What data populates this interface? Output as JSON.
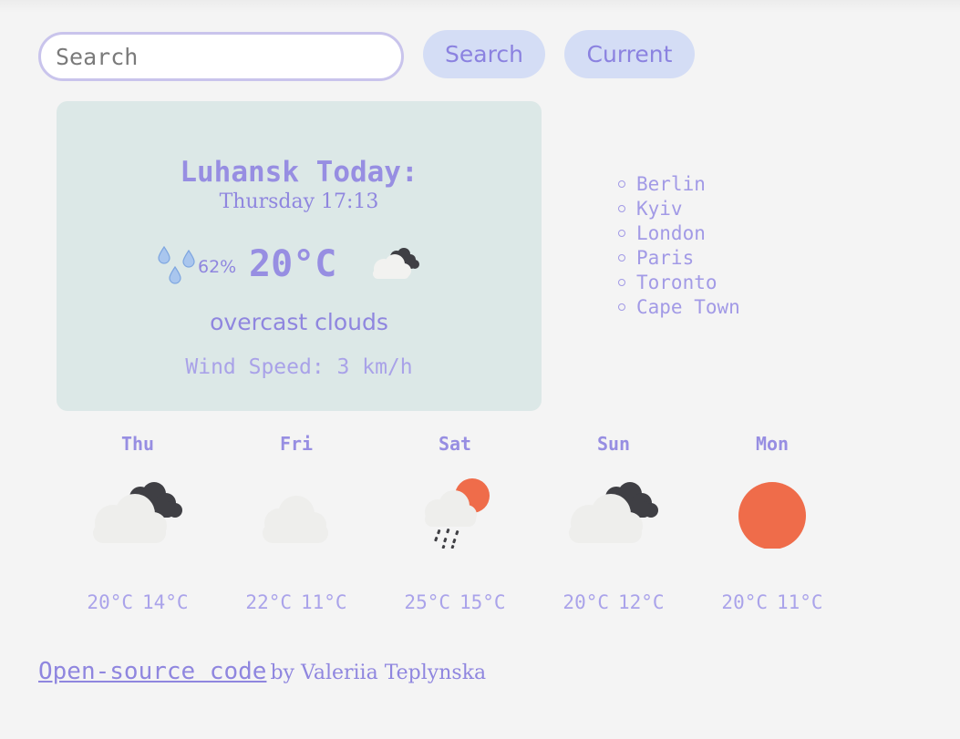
{
  "search": {
    "placeholder": "Search",
    "button_label": "Search",
    "current_label": "Current"
  },
  "today": {
    "title": "Luhansk Today:",
    "datetime": "Thursday 17:13",
    "humidity": "62%",
    "temperature": "20°C",
    "icon": "overcast-clouds-icon",
    "description": "overcast clouds",
    "wind": "Wind Speed: 3 km/h"
  },
  "cities": [
    {
      "name": "Berlin"
    },
    {
      "name": "Kyiv"
    },
    {
      "name": "London"
    },
    {
      "name": "Paris"
    },
    {
      "name": "Toronto"
    },
    {
      "name": "Cape Town"
    }
  ],
  "forecast": [
    {
      "day": "Thu",
      "icon": "overcast-clouds-icon",
      "max": "20°C",
      "min": "14°C"
    },
    {
      "day": "Fri",
      "icon": "cloud-icon",
      "max": "22°C",
      "min": "11°C"
    },
    {
      "day": "Sat",
      "icon": "rain-sun-icon",
      "max": "25°C",
      "min": "15°C"
    },
    {
      "day": "Sun",
      "icon": "overcast-clouds-icon",
      "max": "20°C",
      "min": "12°C"
    },
    {
      "day": "Mon",
      "icon": "sun-icon",
      "max": "20°C",
      "min": "11°C"
    }
  ],
  "footer": {
    "link_text": "Open-source code",
    "byline": "by Valeriia Teplynska"
  },
  "colors": {
    "accent": "#978ee2",
    "card_bg": "#dce8e7",
    "button_bg": "#d4ddf5",
    "sun": "#ef6c4a",
    "dark_cloud": "#3f3f44",
    "light_cloud": "#eeeeec",
    "drop": "#8fb4e6"
  }
}
